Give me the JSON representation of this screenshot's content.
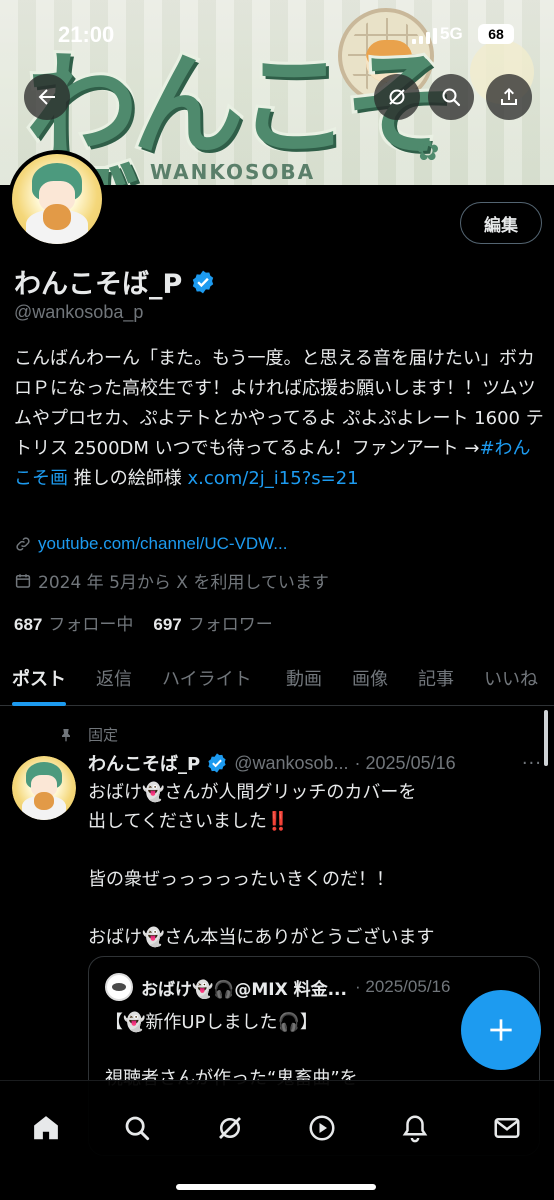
{
  "status_bar": {
    "time": "21:00",
    "network": "5G",
    "battery": "68"
  },
  "banner": {
    "logo_text": "わんこそば",
    "sub_text": "WANKOSOBA"
  },
  "profile": {
    "name": "わんこそば_P",
    "handle": "@wankosoba_p",
    "edit_label": "編集",
    "bio_main": "こんばんわーん「また。もう一度。と思える音を届けたい」ボカロＰになった高校生です！よければ応援お願いします！！ツムツムやプロセカ、ぷよテトとかやってるよ ぷよぷよレート 1600 テトリス 2500DM いつでも待ってるよん！ファンアート →",
    "bio_hashtag": "#わんこそ画",
    "bio_mid": " 推しの絵師様 ",
    "bio_link": "x.com/2j_i15?s=21",
    "website": "youtube.com/channel/UC-VDW...",
    "joined": "2024 年 5月から X を利用しています",
    "following_count": "687",
    "following_label": "フォロー中",
    "followers_count": "697",
    "followers_label": "フォロワー"
  },
  "tabs": [
    {
      "label": "ポスト",
      "active": true
    },
    {
      "label": "返信"
    },
    {
      "label": "ハイライト"
    },
    {
      "label": "動画"
    },
    {
      "label": "画像"
    },
    {
      "label": "記事"
    },
    {
      "label": "いいね"
    }
  ],
  "post": {
    "pinned_label": "固定",
    "author_name": "わんこそば_P",
    "author_handle": "@wankosob...",
    "date": "· 2025/05/16",
    "more": "···",
    "text_line1": "おばけ👻さんが人間グリッチのカバーを",
    "text_line2": "出してくださいました",
    "text_mark": "‼️",
    "text_line3": "皆の衆ぜっっっっったいきくのだ！！",
    "text_line4": "おばけ👻さん本当にありがとうございます"
  },
  "quote": {
    "author": "おばけ👻🎧@MIX 料金...",
    "date": "· 2025/05/16",
    "text": "【👻新作UPしました🎧】\n\n視聴者さんが作った“鬼畜曲”を"
  },
  "colors": {
    "accent": "#1d9bf0",
    "muted": "#71767b",
    "text": "#e7e9ea",
    "border": "#2f3336"
  },
  "bottom_nav": [
    "home-icon",
    "search-icon",
    "grok-icon",
    "video-icon",
    "notifications-icon",
    "messages-icon"
  ]
}
